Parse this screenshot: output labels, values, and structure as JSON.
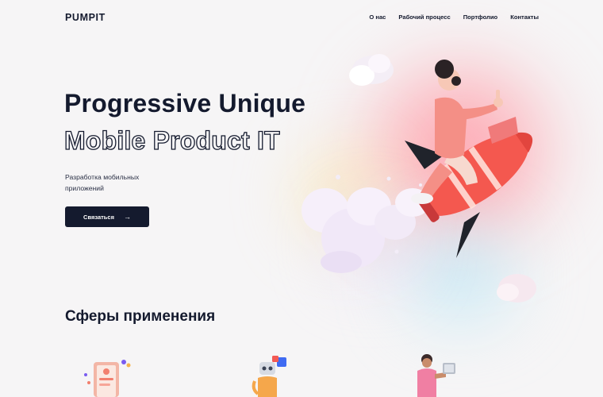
{
  "header": {
    "logo": "PUMPIT",
    "nav": [
      {
        "label": "О нас"
      },
      {
        "label": "Рабочий процесс"
      },
      {
        "label": "Портфолио"
      },
      {
        "label": "Контакты"
      }
    ]
  },
  "hero": {
    "title_line1": "Progressive Unique",
    "title_line2": "Mobile Product IT",
    "subtitle": "Разработка мобильных приложений",
    "cta_label": "Связаться",
    "cta_arrow": "→"
  },
  "section": {
    "title": "Сферы применения"
  },
  "colors": {
    "brand_dark": "#141a2e",
    "background": "#f6f5f6",
    "accent_red": "#f4584f",
    "character_pink": "#f48f86"
  },
  "icons": [
    "rocket-character-illustration",
    "cloud-icon",
    "phone-app-illustration",
    "robot-illustration",
    "person-laptop-illustration"
  ]
}
